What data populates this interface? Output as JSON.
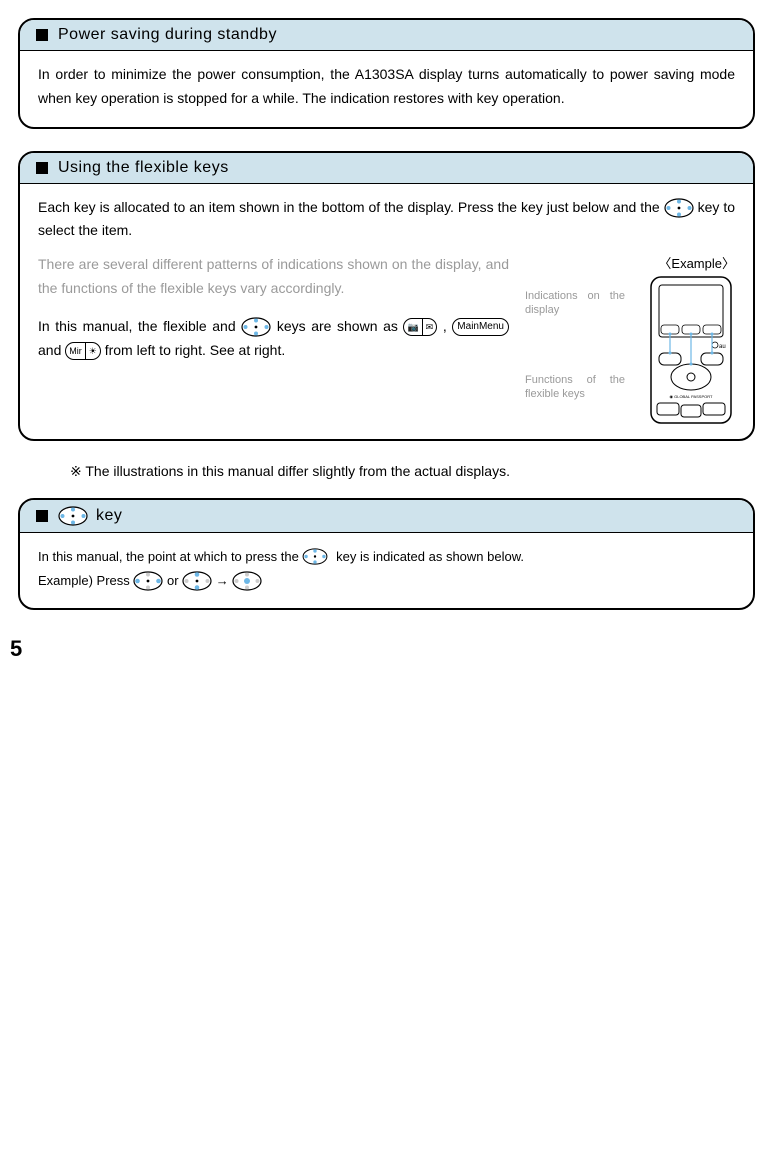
{
  "card1": {
    "title": "Power saving during standby",
    "body": "In order to minimize the power consumption, the A1303SA display turns automatically to power saving mode when key operation is stopped for a while. The indication restores with key operation."
  },
  "card2": {
    "title": "Using the flexible keys",
    "intro_a": "Each key is allocated to an item shown in the bottom of the display. Press the key just below and the ",
    "intro_b": " key to select the item.",
    "gray": "There are several different patterns of indications shown on the display, and the functions of the flexible keys vary accordingly.",
    "manual_a": "In this manual, the flexible and ",
    "manual_b": " keys are shown as ",
    "manual_c": ", ",
    "manual_d": " and ",
    "manual_e": " from left to right. See at right.",
    "example_label": "〈Example〉",
    "annot1": "Indications on the display",
    "annot2": "Functions of the flexible keys",
    "pill_left_a": "📷",
    "pill_left_b": "✉",
    "pill_center": "MainMenu",
    "pill_right_a": "Mir",
    "pill_right_b": "☀"
  },
  "note": "※ The illustrations in this manual differ slightly from the actual displays.",
  "card3": {
    "title": " key",
    "line1_a": "In this manual, the point at which to press the ",
    "line1_b": " key is indicated as shown below.",
    "line2_a": "Example) Press ",
    "line2_or": " or ",
    "line2_arrow": " → "
  },
  "page": "5"
}
